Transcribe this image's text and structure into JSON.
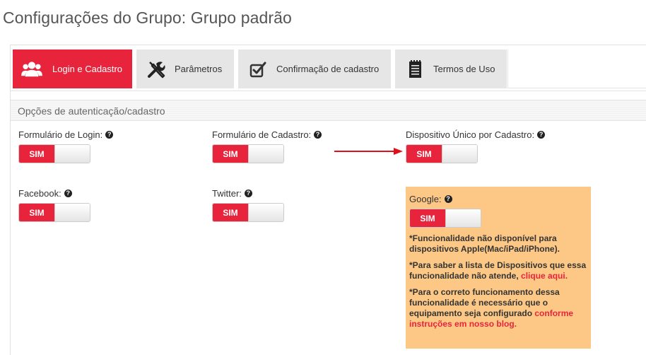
{
  "page": {
    "title": "Configurações do Grupo: Grupo padrão"
  },
  "tabs": [
    {
      "label": "Login e Cadastro",
      "icon": "users-icon",
      "active": true
    },
    {
      "label": "Parâmetros",
      "icon": "tools-icon",
      "active": false
    },
    {
      "label": "Confirmação de cadastro",
      "icon": "checkbox-icon",
      "active": false
    },
    {
      "label": "Termos de Uso",
      "icon": "document-icon",
      "active": false
    }
  ],
  "section": {
    "title": "Opções de autenticação/cadastro"
  },
  "fields": {
    "login_form": {
      "label": "Formulário de Login:",
      "toggle": "SIM"
    },
    "signup_form": {
      "label": "Formulário de Cadastro:",
      "toggle": "SIM"
    },
    "single_device": {
      "label": "Dispositivo Único por Cadastro:",
      "toggle": "SIM"
    },
    "facebook": {
      "label": "Facebook:",
      "toggle": "SIM"
    },
    "twitter": {
      "label": "Twitter:",
      "toggle": "SIM"
    },
    "google": {
      "label": "Google:",
      "toggle": "SIM"
    }
  },
  "help_glyph": "?",
  "google_notes": {
    "note1": "*Funcionalidade não disponível para dispositivos Apple(Mac/iPad/iPhone).",
    "note2_text": "*Para saber a lista de Dispositivos que essa funcionalidade não atende, ",
    "note2_link": "clique aqui.",
    "note3_text": "*Para o correto funcionamento dessa funcionalidade é necessário que o equipamento seja configurado ",
    "note3_link": "conforme instruções em nosso blog."
  },
  "colors": {
    "accent": "#e8243c",
    "tab_inactive": "#e6e6e6",
    "notice_bg": "#fdc886",
    "arrow": "#e0101a"
  }
}
